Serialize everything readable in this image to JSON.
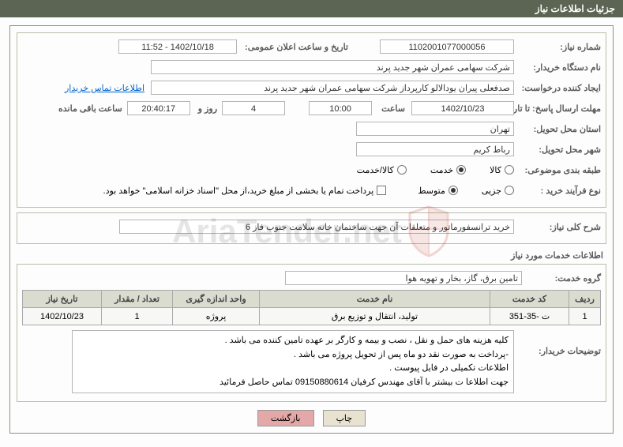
{
  "title_bar": "جزئیات اطلاعات نیاز",
  "fields": {
    "need_no_label": "شماره نیاز:",
    "need_no": "1102001077000056",
    "announce_date_label": "تاریخ و ساعت اعلان عمومی:",
    "announce_date": "1402/10/18 - 11:52",
    "buyer_org_label": "نام دستگاه خریدار:",
    "buyer_org": "شرکت سهامی عمران شهر جدید پرند",
    "requester_label": "ایجاد کننده درخواست:",
    "requester": "صدفعلی پیران یودالالو کارپرداز شرکت سهامی عمران شهر جدید پرند",
    "buyer_contact_link": "اطلاعات تماس خریدار",
    "deadline_label": "مهلت ارسال پاسخ: تا تاریخ:",
    "deadline_date": "1402/10/23",
    "time_label": "ساعت",
    "deadline_time": "10:00",
    "days_remain": "4",
    "days_remain_label": "روز و",
    "time_remain": "20:40:17",
    "time_remain_label": "ساعت باقی مانده",
    "province_label": "استان محل تحویل:",
    "province": "تهران",
    "city_label": "شهر محل تحویل:",
    "city": "رباط کریم",
    "category_label": "طبقه بندی موضوعی:",
    "cat_goods": "کالا",
    "cat_service": "خدمت",
    "cat_both": "کالا/خدمت",
    "process_label": "نوع فرآیند خرید :",
    "proc_minor": "جزیی",
    "proc_medium": "متوسط",
    "payment_note": "پرداخت تمام یا بخشی از مبلغ خرید،از محل \"اسناد خزانه اسلامی\" خواهد بود."
  },
  "summary": {
    "label": "شرح کلی نیاز:",
    "text": "خرید ترانسفورماتور و متعلقات آن جهت ساختمان خانه سلامت جنوب فاز 6"
  },
  "services_section_title": "اطلاعات خدمات مورد نیاز",
  "group": {
    "label": "گروه خدمت:",
    "text": "تامین برق، گاز، بخار و تهویه هوا"
  },
  "table": {
    "headers": {
      "row": "ردیف",
      "code": "کد خدمت",
      "name": "نام خدمت",
      "unit": "واحد اندازه گیری",
      "qty": "تعداد / مقدار",
      "date": "تاریخ نیاز"
    },
    "rows": [
      {
        "row": "1",
        "code": "ت -35-351",
        "name": "تولید، انتقال و توزیع برق",
        "unit": "پروژه",
        "qty": "1",
        "date": "1402/10/23"
      }
    ]
  },
  "buyer_notes": {
    "label": "توضیحات خریدار:",
    "line1": "کلیه هزینه های حمل و نقل ، نصب و بیمه و کارگر بر عهده تامین کننده  می باشد .",
    "line2": "-پرداخت به صورت نقد دو ماه پس از تحویل پروژه  می باشد  .",
    "line3": "اطلاعات تکمیلی در فایل پیوست .",
    "line4": "جهت اطلاعا ت بیشتر با آقای مهندس کرفیان  09150880614 تماس حاصل فرمائید"
  },
  "buttons": {
    "print": "چاپ",
    "back": "بازگشت"
  },
  "watermark": "AriaTender.net"
}
